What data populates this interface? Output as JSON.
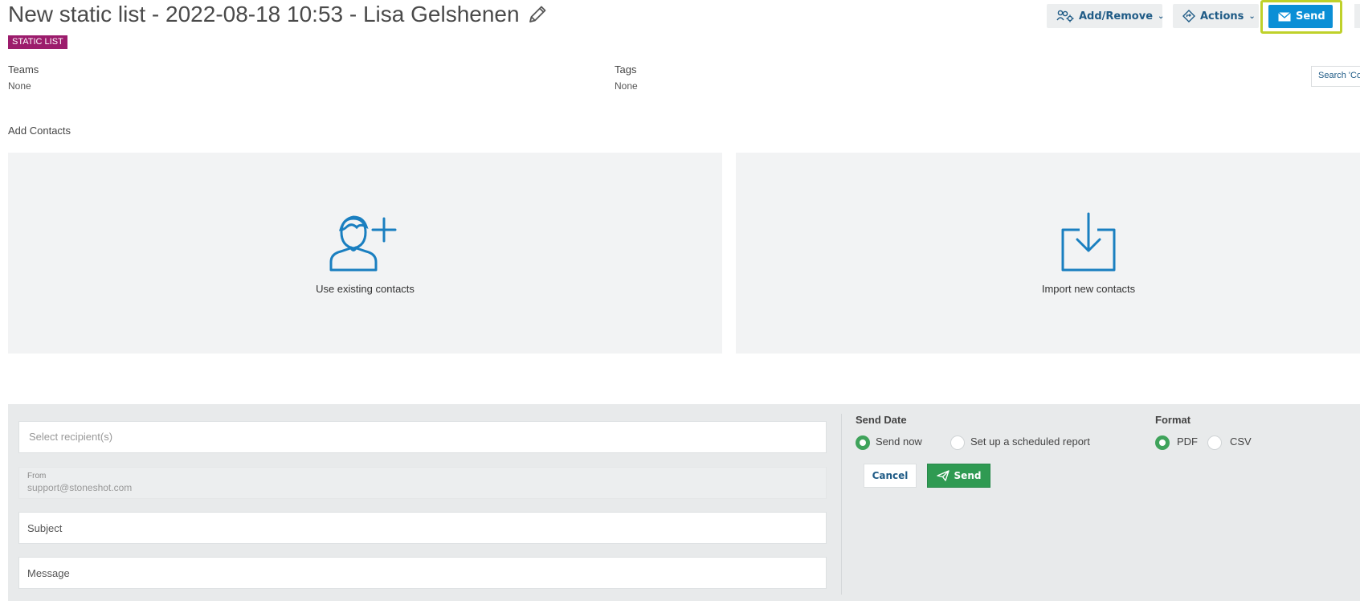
{
  "header": {
    "title": "New static list - 2022-08-18 10:53 - Lisa Gelshenen",
    "badge": "STATIC LIST",
    "add_remove_label": "Add/Remove",
    "actions_label": "Actions",
    "send_label": "Send"
  },
  "meta": {
    "teams_label": "Teams",
    "teams_value": "None",
    "tags_label": "Tags",
    "tags_value": "None",
    "search_placeholder": "Search 'Co"
  },
  "add_contacts": {
    "label": "Add Contacts",
    "existing_label": "Use existing contacts",
    "import_label": "Import new contacts"
  },
  "send_form": {
    "recipient_placeholder": "Select recipient(s)",
    "from_label": "From",
    "from_value": "support@stoneshot.com",
    "subject_placeholder": "Subject",
    "message_placeholder": "Message",
    "send_date_label": "Send Date",
    "send_now_label": "Send now",
    "scheduled_label": "Set up a scheduled report",
    "format_label": "Format",
    "pdf_label": "PDF",
    "csv_label": "CSV",
    "cancel_label": "Cancel",
    "send_label": "Send"
  },
  "colors": {
    "badge": "#9c1c6c",
    "primary_blue": "#0b8fd6",
    "highlight": "#bfd12a",
    "success_green": "#2f9a52",
    "icon_blue": "#1a7fc0"
  }
}
